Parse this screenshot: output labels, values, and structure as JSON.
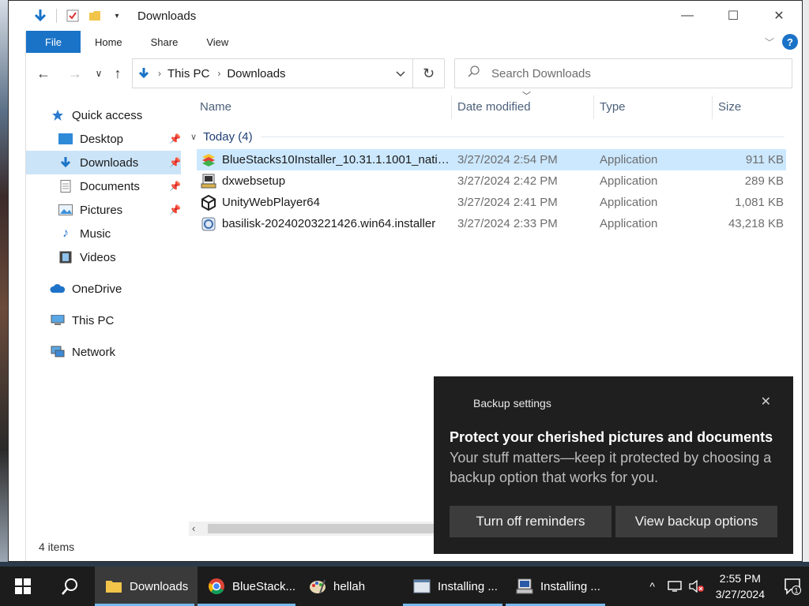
{
  "window": {
    "title": "Downloads",
    "ribbon_tabs": [
      "File",
      "Home",
      "Share",
      "View"
    ]
  },
  "address": {
    "segments": [
      "This PC",
      "Downloads"
    ],
    "search_placeholder": "Search Downloads"
  },
  "nav": {
    "quick_access": "Quick access",
    "pinned": [
      {
        "label": "Desktop",
        "pinned": true
      },
      {
        "label": "Downloads",
        "pinned": true,
        "selected": true
      },
      {
        "label": "Documents",
        "pinned": true
      },
      {
        "label": "Pictures",
        "pinned": true
      },
      {
        "label": "Music",
        "pinned": false
      },
      {
        "label": "Videos",
        "pinned": false
      }
    ],
    "onedrive": "OneDrive",
    "this_pc": "This PC",
    "network": "Network"
  },
  "list": {
    "columns": {
      "name": "Name",
      "date": "Date modified",
      "type": "Type",
      "size": "Size"
    },
    "group": "Today (4)",
    "rows": [
      {
        "name": "BlueStacks10Installer_10.31.1.1001_native...",
        "date": "3/27/2024 2:54 PM",
        "type": "Application",
        "size": "911 KB",
        "icon": "bluestacks-icon",
        "selected": true
      },
      {
        "name": "dxwebsetup",
        "date": "3/27/2024 2:42 PM",
        "type": "Application",
        "size": "289 KB",
        "icon": "installer-icon",
        "selected": false
      },
      {
        "name": "UnityWebPlayer64",
        "date": "3/27/2024 2:41 PM",
        "type": "Application",
        "size": "1,081 KB",
        "icon": "unity-icon",
        "selected": false
      },
      {
        "name": "basilisk-20240203221426.win64.installer",
        "date": "3/27/2024 2:33 PM",
        "type": "Application",
        "size": "43,218 KB",
        "icon": "setup-icon",
        "selected": false
      }
    ]
  },
  "status": {
    "items": "4 items"
  },
  "toast": {
    "title": "Backup settings",
    "heading": "Protect your cherished pictures and documents",
    "body": "Your stuff matters—keep it protected by choosing a backup option that works for you.",
    "btn_off": "Turn off reminders",
    "btn_view": "View backup options"
  },
  "taskbar": {
    "apps": [
      {
        "label": "Downloads",
        "icon": "folder-icon"
      },
      {
        "label": "BlueStack...",
        "icon": "chrome-icon"
      },
      {
        "label": "hellah",
        "icon": "paint-icon"
      },
      {
        "label": "Installing ...",
        "icon": "window-icon"
      },
      {
        "label": "Installing ...",
        "icon": "installer-icon"
      }
    ],
    "time": "2:55 PM",
    "date": "3/27/2024",
    "notifications": "1"
  },
  "colors": {
    "accent": "#1a73c7",
    "selection": "#cce8ff",
    "toast_bg": "#1f1f1f",
    "taskbar_bg": "#1c1c1c"
  }
}
